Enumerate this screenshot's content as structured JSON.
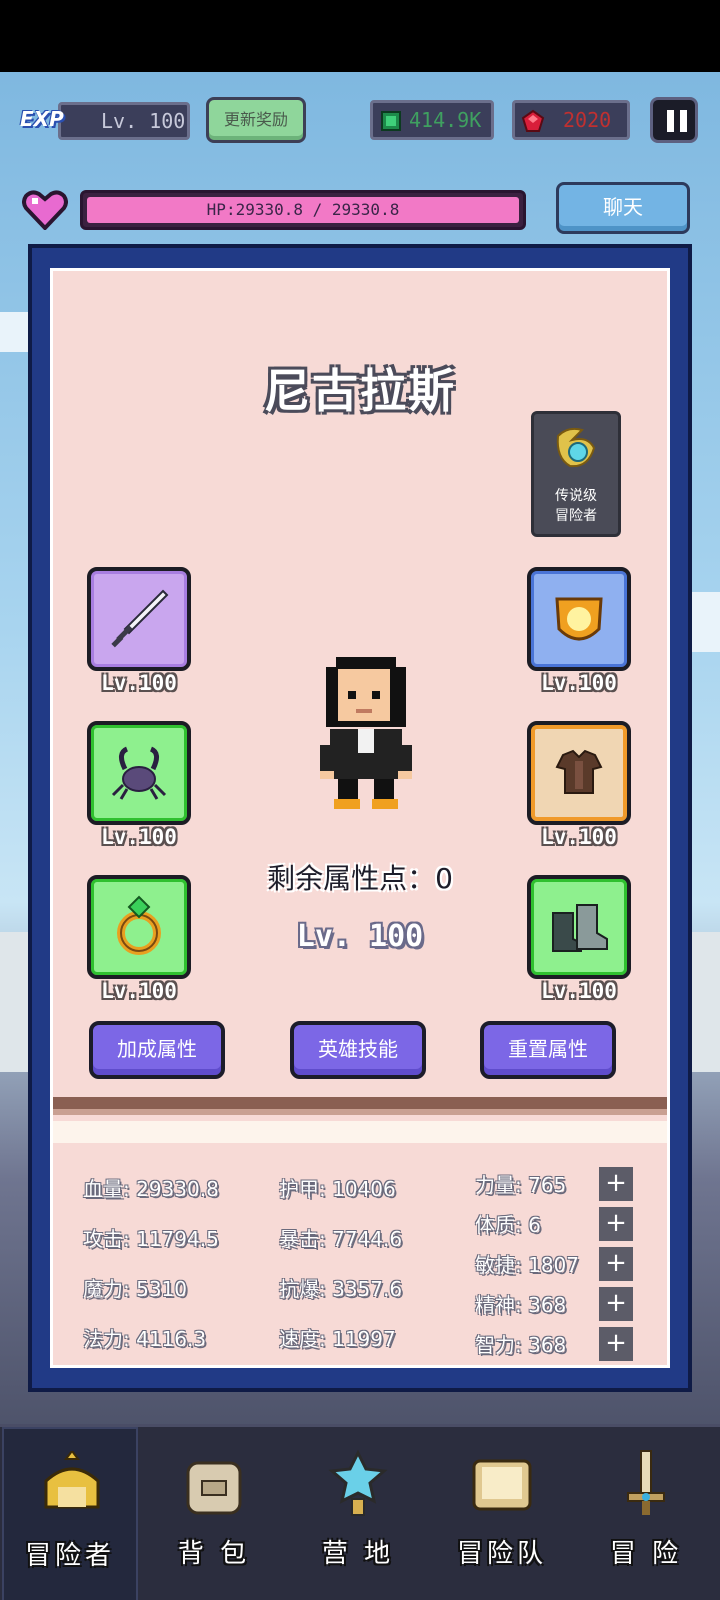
{
  "top_bar": {
    "exp_tag": "EXP",
    "level": "Lv. 100",
    "update_reward_label": "更新奖励",
    "gems": "414.9K",
    "rubies": "2020"
  },
  "hp": {
    "text": "HP:29330.8 / 29330.8",
    "fraction": 1.0
  },
  "chat_label": "聊天",
  "hero": {
    "name": "尼古拉斯",
    "rank_line1": "传说级",
    "rank_line2": "冒险者",
    "remaining_points": "剩余属性点：0",
    "level": "Lv. 100"
  },
  "equipment": {
    "weapon_lv": "Lv.100",
    "helmet_lv": "Lv.100",
    "pet_lv": "Lv.100",
    "armor_lv": "Lv.100",
    "ring_lv": "Lv.100",
    "boots_lv": "Lv.100"
  },
  "actions": {
    "bonus_attr": "加成属性",
    "hero_skill": "英雄技能",
    "reset_attr": "重置属性"
  },
  "stats": {
    "hp": "血量: 29330.8",
    "attack": "攻击: 11794.5",
    "magic": "魔力: 5310",
    "spell": "法力: 4116.3",
    "armor": "护甲: 10406",
    "crit": "暴击: 7744.6",
    "anti_crit": "抗爆: 3357.6",
    "speed": "速度: 11997",
    "strength": "力量: 765",
    "constitution": "体质: 6",
    "agility": "敏捷: 1807",
    "spirit": "精神: 368",
    "intellect": "智力: 368",
    "plus": "+"
  },
  "nav": {
    "adventurer": "冒险者",
    "backpack": "背 包",
    "camp": "营 地",
    "team": "冒险队",
    "adventure": "冒 险"
  },
  "colors": {
    "panel_border": "#213a86",
    "panel_bg": "#f7dad6",
    "hp_fill": "#f279c6",
    "action_button": "#7c67e6",
    "chat_button": "#73b4e4"
  }
}
